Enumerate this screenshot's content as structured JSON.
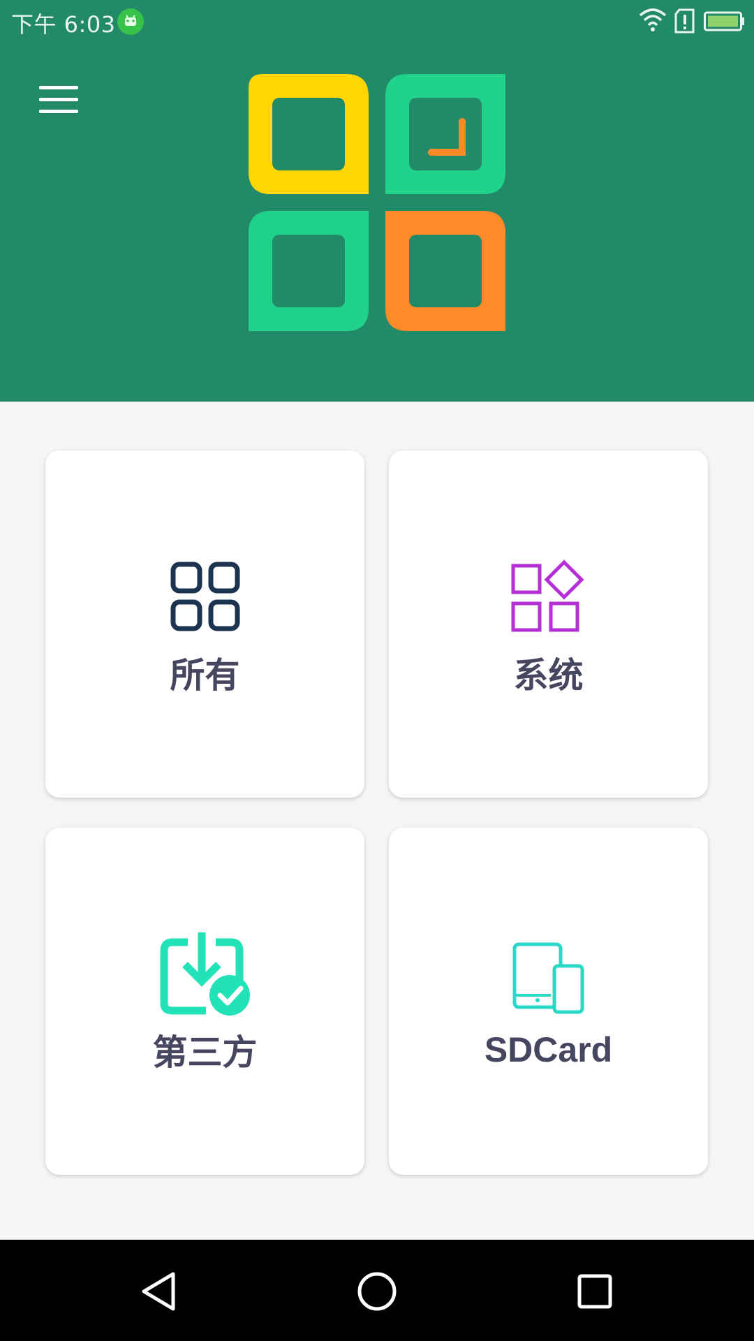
{
  "status_bar": {
    "time": "下午 6:03",
    "icons": [
      "android-icon",
      "wifi-icon",
      "sim-alert-icon",
      "battery-icon"
    ]
  },
  "header": {
    "menu_icon": "hamburger-menu-icon",
    "logo": "app-logo",
    "colors": {
      "background": "#228a69",
      "yellow": "#ffd600",
      "green": "#20d28a",
      "orange": "#ff8a28"
    }
  },
  "categories": [
    {
      "label": "所有",
      "icon": "grid-squares-icon",
      "color": "#1d3450"
    },
    {
      "label": "系统",
      "icon": "apps-diamond-icon",
      "color": "#b52fd6"
    },
    {
      "label": "第三方",
      "icon": "download-check-icon",
      "color": "#22e3b8"
    },
    {
      "label": "SDCard",
      "icon": "tablet-phone-icon",
      "color": "#2ad8c8"
    }
  ],
  "navigation_bar": {
    "icons": [
      "back-icon",
      "home-icon",
      "recent-apps-icon"
    ]
  }
}
